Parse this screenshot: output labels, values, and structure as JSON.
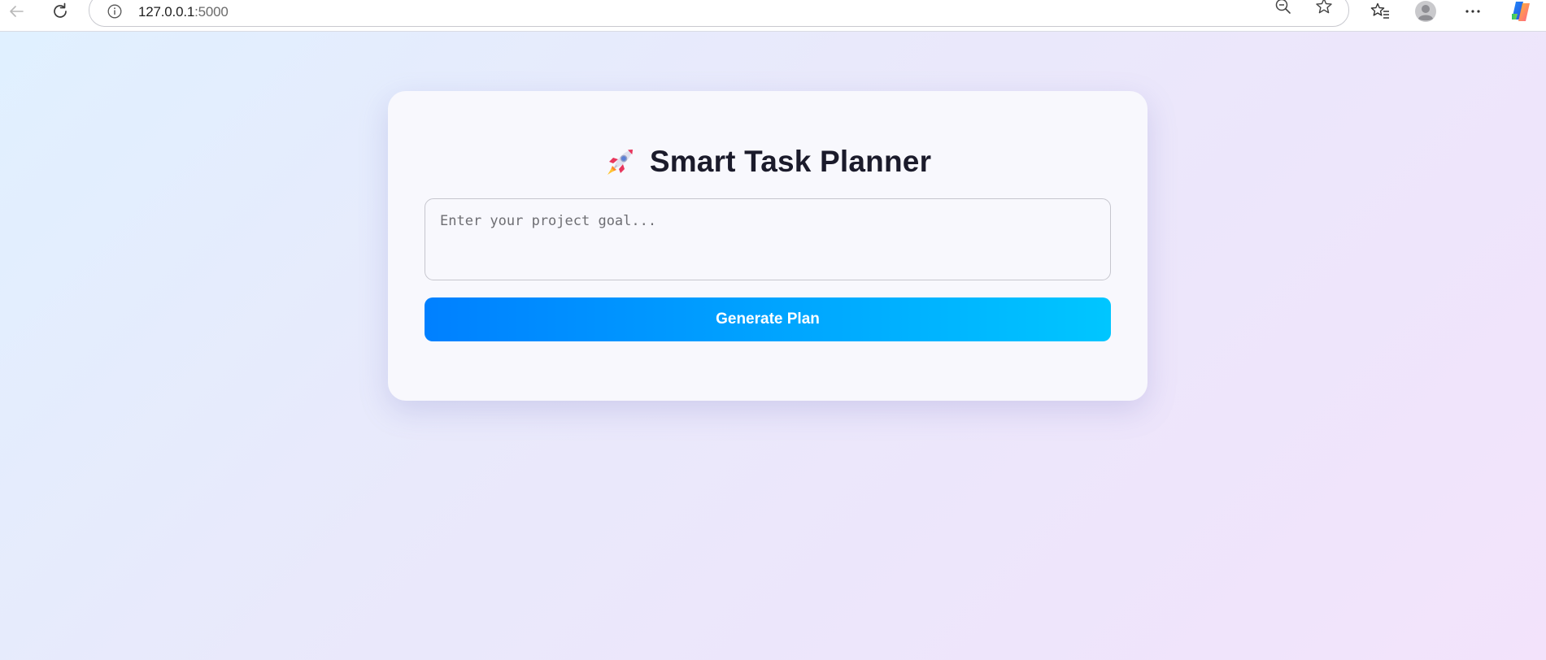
{
  "browser": {
    "url_host": "127.0.0.1",
    "url_port": ":5000",
    "icons": [
      "back-icon",
      "reload-icon",
      "site-info-icon",
      "zoom-out-icon",
      "star-icon",
      "favorites-icon",
      "profile-icon",
      "more-icon",
      "copilot-icon"
    ]
  },
  "app": {
    "title": "Smart Task Planner",
    "title_icon": "rocket-icon",
    "goal_input": {
      "placeholder": "Enter your project goal...",
      "value": ""
    },
    "generate_button_label": "Generate Plan",
    "colors": {
      "button_gradient_start": "#0080ff",
      "button_gradient_end": "#00c6ff",
      "title": "#1b1b2b",
      "card_background": "#f8f8fd"
    }
  }
}
